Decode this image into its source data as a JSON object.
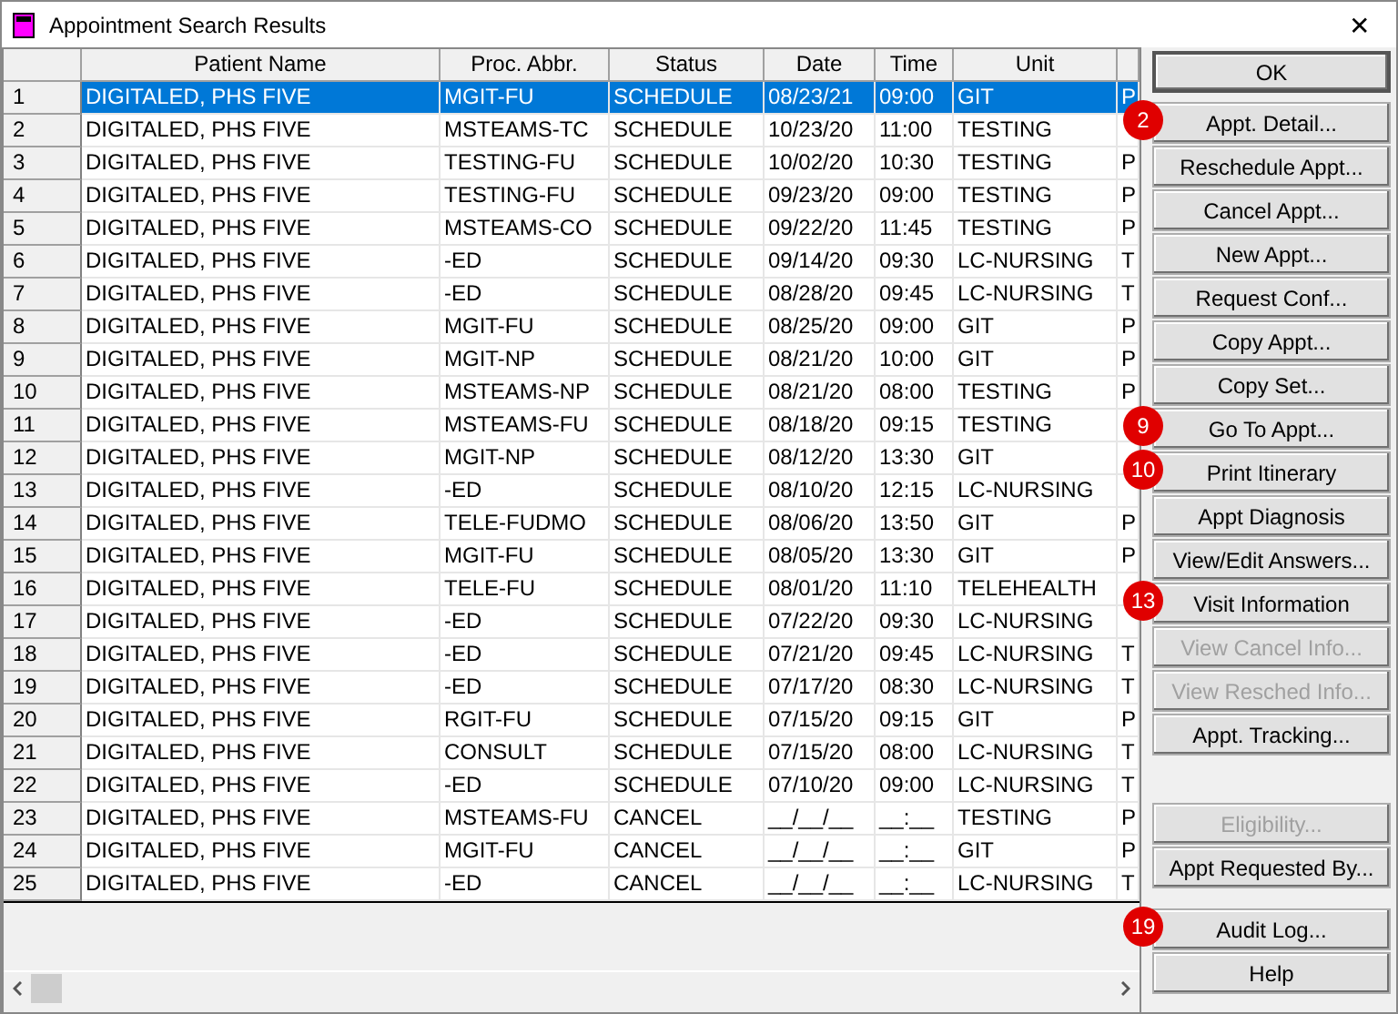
{
  "window": {
    "title": "Appointment Search Results",
    "close": "✕"
  },
  "table": {
    "columns": [
      "Patient Name",
      "Proc. Abbr.",
      "Status",
      "Date",
      "Time",
      "Unit"
    ],
    "rows": [
      {
        "num": "1",
        "cells": [
          "DIGITALED, PHS FIVE",
          "MGIT-FU",
          "SCHEDULE",
          "08/23/21",
          "09:00",
          "GIT",
          "P"
        ],
        "selected": true
      },
      {
        "num": "2",
        "cells": [
          "DIGITALED, PHS FIVE",
          "MSTEAMS-TC",
          "SCHEDULE",
          "10/23/20",
          "11:00",
          "TESTING"
        ],
        "selected": false
      },
      {
        "num": "3",
        "cells": [
          "DIGITALED, PHS FIVE",
          "TESTING-FU",
          "SCHEDULE",
          "10/02/20",
          "10:30",
          "TESTING",
          "P"
        ],
        "selected": false
      },
      {
        "num": "4",
        "cells": [
          "DIGITALED, PHS FIVE",
          "TESTING-FU",
          "SCHEDULE",
          "09/23/20",
          "09:00",
          "TESTING",
          "P"
        ],
        "selected": false
      },
      {
        "num": "5",
        "cells": [
          "DIGITALED, PHS FIVE",
          "MSTEAMS-CO",
          "SCHEDULE",
          "09/22/20",
          "11:45",
          "TESTING",
          "P"
        ],
        "selected": false
      },
      {
        "num": "6",
        "cells": [
          "DIGITALED, PHS FIVE",
          "-ED",
          "SCHEDULE",
          "09/14/20",
          "09:30",
          "LC-NURSING",
          "T"
        ],
        "selected": false
      },
      {
        "num": "7",
        "cells": [
          "DIGITALED, PHS FIVE",
          "-ED",
          "SCHEDULE",
          "08/28/20",
          "09:45",
          "LC-NURSING",
          "T"
        ],
        "selected": false
      },
      {
        "num": "8",
        "cells": [
          "DIGITALED, PHS FIVE",
          "MGIT-FU",
          "SCHEDULE",
          "08/25/20",
          "09:00",
          "GIT",
          "P"
        ],
        "selected": false
      },
      {
        "num": "9",
        "cells": [
          "DIGITALED, PHS FIVE",
          "MGIT-NP",
          "SCHEDULE",
          "08/21/20",
          "10:00",
          "GIT",
          "P"
        ],
        "selected": false
      },
      {
        "num": "10",
        "cells": [
          "DIGITALED, PHS FIVE",
          "MSTEAMS-NP",
          "SCHEDULE",
          "08/21/20",
          "08:00",
          "TESTING",
          "P"
        ],
        "selected": false
      },
      {
        "num": "11",
        "cells": [
          "DIGITALED, PHS FIVE",
          "MSTEAMS-FU",
          "SCHEDULE",
          "08/18/20",
          "09:15",
          "TESTING"
        ],
        "selected": false
      },
      {
        "num": "12",
        "cells": [
          "DIGITALED, PHS FIVE",
          "MGIT-NP",
          "SCHEDULE",
          "08/12/20",
          "13:30",
          "GIT"
        ],
        "selected": false
      },
      {
        "num": "13",
        "cells": [
          "DIGITALED, PHS FIVE",
          "-ED",
          "SCHEDULE",
          "08/10/20",
          "12:15",
          "LC-NURSING"
        ],
        "selected": false
      },
      {
        "num": "14",
        "cells": [
          "DIGITALED, PHS FIVE",
          "TELE-FUDMO",
          "SCHEDULE",
          "08/06/20",
          "13:50",
          "GIT",
          "P"
        ],
        "selected": false
      },
      {
        "num": "15",
        "cells": [
          "DIGITALED, PHS FIVE",
          "MGIT-FU",
          "SCHEDULE",
          "08/05/20",
          "13:30",
          "GIT",
          "P"
        ],
        "selected": false
      },
      {
        "num": "16",
        "cells": [
          "DIGITALED, PHS FIVE",
          "TELE-FU",
          "SCHEDULE",
          "08/01/20",
          "11:10",
          "TELEHEALTH"
        ],
        "selected": false
      },
      {
        "num": "17",
        "cells": [
          "DIGITALED, PHS FIVE",
          "-ED",
          "SCHEDULE",
          "07/22/20",
          "09:30",
          "LC-NURSING"
        ],
        "selected": false
      },
      {
        "num": "18",
        "cells": [
          "DIGITALED, PHS FIVE",
          "-ED",
          "SCHEDULE",
          "07/21/20",
          "09:45",
          "LC-NURSING",
          "T"
        ],
        "selected": false
      },
      {
        "num": "19",
        "cells": [
          "DIGITALED, PHS FIVE",
          "-ED",
          "SCHEDULE",
          "07/17/20",
          "08:30",
          "LC-NURSING",
          "T"
        ],
        "selected": false
      },
      {
        "num": "20",
        "cells": [
          "DIGITALED, PHS FIVE",
          "RGIT-FU",
          "SCHEDULE",
          "07/15/20",
          "09:15",
          "GIT",
          "P"
        ],
        "selected": false
      },
      {
        "num": "21",
        "cells": [
          "DIGITALED, PHS FIVE",
          "CONSULT",
          "SCHEDULE",
          "07/15/20",
          "08:00",
          "LC-NURSING",
          "T"
        ],
        "selected": false
      },
      {
        "num": "22",
        "cells": [
          "DIGITALED, PHS FIVE",
          "-ED",
          "SCHEDULE",
          "07/10/20",
          "09:00",
          "LC-NURSING",
          "T"
        ],
        "selected": false
      },
      {
        "num": "23",
        "cells": [
          "DIGITALED, PHS FIVE",
          "MSTEAMS-FU",
          "CANCEL",
          "__/__/__",
          "__:__",
          "TESTING",
          "P"
        ],
        "selected": false
      },
      {
        "num": "24",
        "cells": [
          "DIGITALED, PHS FIVE",
          "MGIT-FU",
          "CANCEL",
          "__/__/__",
          "__:__",
          "GIT",
          "P"
        ],
        "selected": false
      },
      {
        "num": "25",
        "cells": [
          "DIGITALED, PHS FIVE",
          "-ED",
          "CANCEL",
          "__/__/__",
          "__:__",
          "LC-NURSING",
          "T"
        ],
        "selected": false
      }
    ]
  },
  "button_groups": [
    [
      {
        "label": "OK",
        "disabled": false,
        "default": true
      }
    ],
    [
      {
        "label": "Appt. Detail...",
        "disabled": false,
        "badge": "2"
      },
      {
        "label": "Reschedule Appt...",
        "disabled": false
      },
      {
        "label": "Cancel Appt...",
        "disabled": false
      },
      {
        "label": "New Appt...",
        "disabled": false
      },
      {
        "label": "Request Conf...",
        "disabled": false
      },
      {
        "label": "Copy Appt...",
        "disabled": false
      },
      {
        "label": "Copy Set...",
        "disabled": false
      },
      {
        "label": "Go To Appt...",
        "disabled": false,
        "badge": "9"
      },
      {
        "label": "Print Itinerary",
        "disabled": false,
        "badge": "10"
      },
      {
        "label": "Appt Diagnosis",
        "disabled": false
      },
      {
        "label": "View/Edit Answers...",
        "disabled": false
      },
      {
        "label": "Visit Information",
        "disabled": false,
        "badge": "13"
      },
      {
        "label": "View Cancel Info...",
        "disabled": true
      },
      {
        "label": "View Resched Info...",
        "disabled": true
      },
      {
        "label": "Appt. Tracking...",
        "disabled": false
      }
    ],
    [
      {
        "label": "Eligibility...",
        "disabled": true
      },
      {
        "label": "Appt Requested By...",
        "disabled": false
      }
    ],
    [
      {
        "label": "Audit Log...",
        "disabled": false,
        "badge": "19"
      },
      {
        "label": "Help",
        "disabled": false
      }
    ]
  ]
}
